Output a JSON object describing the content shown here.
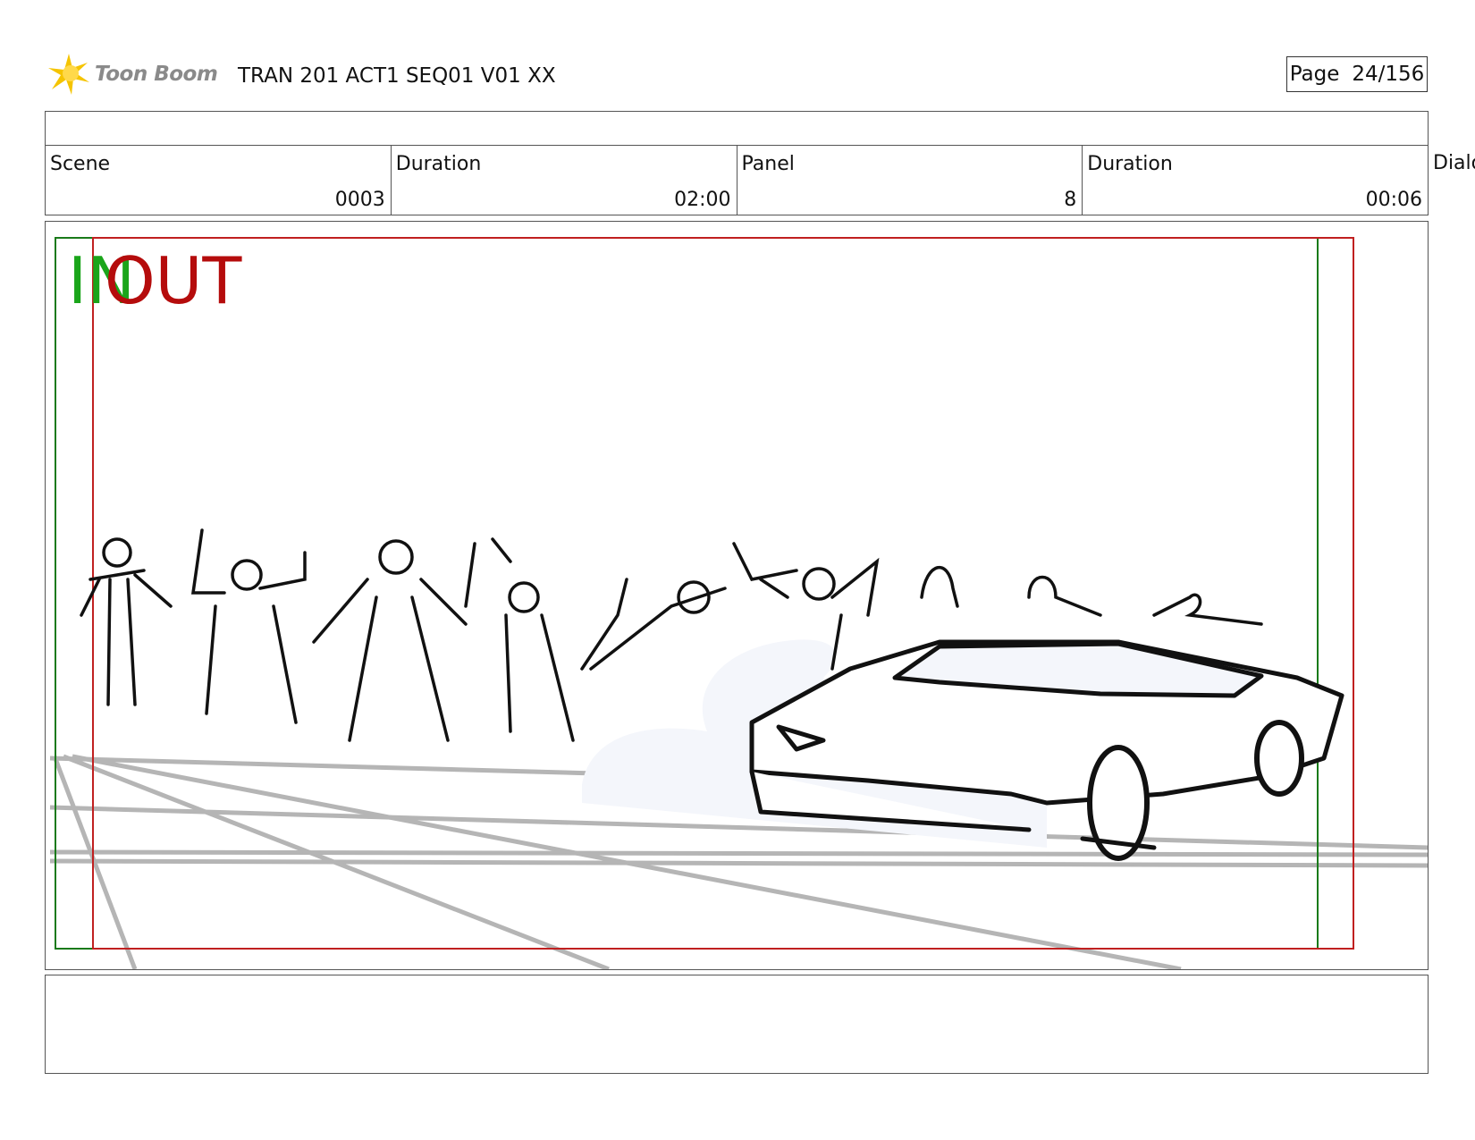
{
  "header": {
    "logo_text": "Toon Boom",
    "title": "TRAN 201 ACT1 SEQ01 V01 XX",
    "page_label": "Page",
    "page_value": "24/156"
  },
  "info": {
    "scene_label": "Scene",
    "scene_value": "0003",
    "scene_duration_label": "Duration",
    "scene_duration_value": "02:00",
    "panel_label": "Panel",
    "panel_value": "8",
    "panel_duration_label": "Duration",
    "panel_duration_value": "00:06",
    "dialog_label": "Dialog"
  },
  "frame": {
    "in_label": "IN",
    "out_label": "OUT",
    "in_color": "#1aa51a",
    "out_color": "#b50c0c",
    "sketch_subject": "crowd-and-sports-car-sketch-icon"
  },
  "colors": {
    "logo_star": "#f5c400",
    "guide_lines": "#b5b5b5"
  }
}
